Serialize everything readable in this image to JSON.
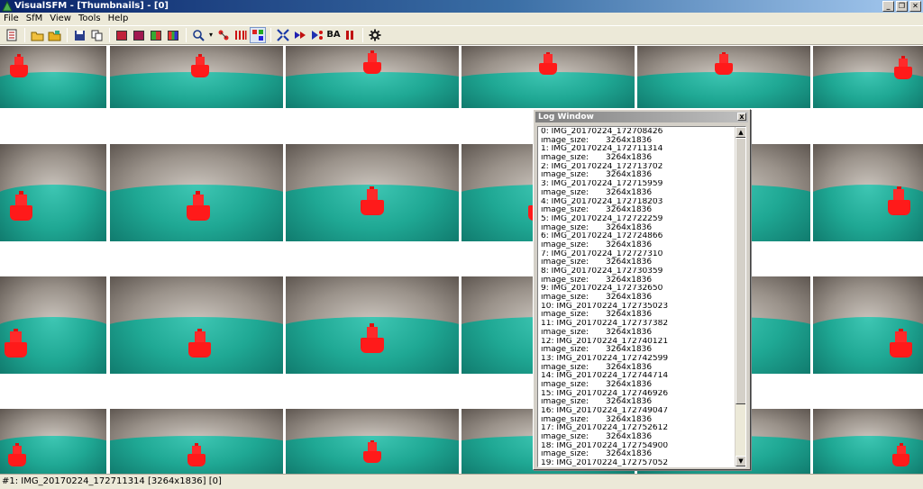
{
  "window": {
    "title": "VisualSFM - [Thumbnails] - [0]",
    "controls": [
      "_",
      "❐",
      "✕"
    ]
  },
  "menu": [
    "File",
    "SfM",
    "View",
    "Tools",
    "Help"
  ],
  "toolbar": {
    "groups": [
      [
        "log-icon"
      ],
      [
        "open-icon",
        "open-multi-icon"
      ],
      [
        "save-icon",
        "copy-icon"
      ],
      [
        "view-a-icon",
        "view-b-icon",
        "view-c-icon",
        "view-d-icon"
      ],
      [
        "search-icon",
        "dropdown-icon",
        "match-icon",
        "pairs-icon",
        "sfm-icon"
      ],
      [
        "compute-icon",
        "arrow-icon",
        "dense-icon",
        "ba-icon",
        "pause-icon"
      ],
      [
        "settings-icon"
      ]
    ],
    "ba_label": "BA"
  },
  "log_window": {
    "title": "Log Window",
    "close": "x",
    "entries": [
      {
        "label": "0: IMG_20170224_172708426"
      },
      {
        "label": "image_size:",
        "value": "3264x1836"
      },
      {
        "label": "1: IMG_20170224_172711314"
      },
      {
        "label": "image_size:",
        "value": "3264x1836"
      },
      {
        "label": "2: IMG_20170224_172713702"
      },
      {
        "label": "image_size:",
        "value": "3264x1836"
      },
      {
        "label": "3: IMG_20170224_172715959"
      },
      {
        "label": "image_size:",
        "value": "3264x1836"
      },
      {
        "label": "4: IMG_20170224_172718203"
      },
      {
        "label": "image_size:",
        "value": "3264x1836"
      },
      {
        "label": "5: IMG_20170224_172722259"
      },
      {
        "label": "image_size:",
        "value": "3264x1836"
      },
      {
        "label": "6: IMG_20170224_172724866"
      },
      {
        "label": "image_size:",
        "value": "3264x1836"
      },
      {
        "label": "7: IMG_20170224_172727310"
      },
      {
        "label": "image_size:",
        "value": "3264x1836"
      },
      {
        "label": "8: IMG_20170224_172730359"
      },
      {
        "label": "image_size:",
        "value": "3264x1836"
      },
      {
        "label": "9: IMG_20170224_172732650"
      },
      {
        "label": "image_size:",
        "value": "3264x1836"
      },
      {
        "label": "10: IMG_20170224_172735023"
      },
      {
        "label": "image_size:",
        "value": "3264x1836"
      },
      {
        "label": "11: IMG_20170224_172737382"
      },
      {
        "label": "image_size:",
        "value": "3264x1836"
      },
      {
        "label": "12: IMG_20170224_172740121"
      },
      {
        "label": "image_size:",
        "value": "3264x1836"
      },
      {
        "label": "13: IMG_20170224_172742599"
      },
      {
        "label": "image_size:",
        "value": "3264x1836"
      },
      {
        "label": "14: IMG_20170224_172744714"
      },
      {
        "label": "image_size:",
        "value": "3264x1836"
      },
      {
        "label": "15: IMG_20170224_172746926"
      },
      {
        "label": "image_size:",
        "value": "3264x1836"
      },
      {
        "label": "16: IMG_20170224_172749047"
      },
      {
        "label": "image_size:",
        "value": "3264x1836"
      },
      {
        "label": "17: IMG_20170224_172752612"
      },
      {
        "label": "image_size:",
        "value": "3264x1836"
      },
      {
        "label": "18: IMG_20170224_172754900"
      },
      {
        "label": "image_size:",
        "value": "3264x1836"
      },
      {
        "label": "19: IMG_20170224_172757052"
      }
    ]
  },
  "statusbar": {
    "text": "#1: IMG_20170224_172711314 [3264x1836] [0]"
  }
}
